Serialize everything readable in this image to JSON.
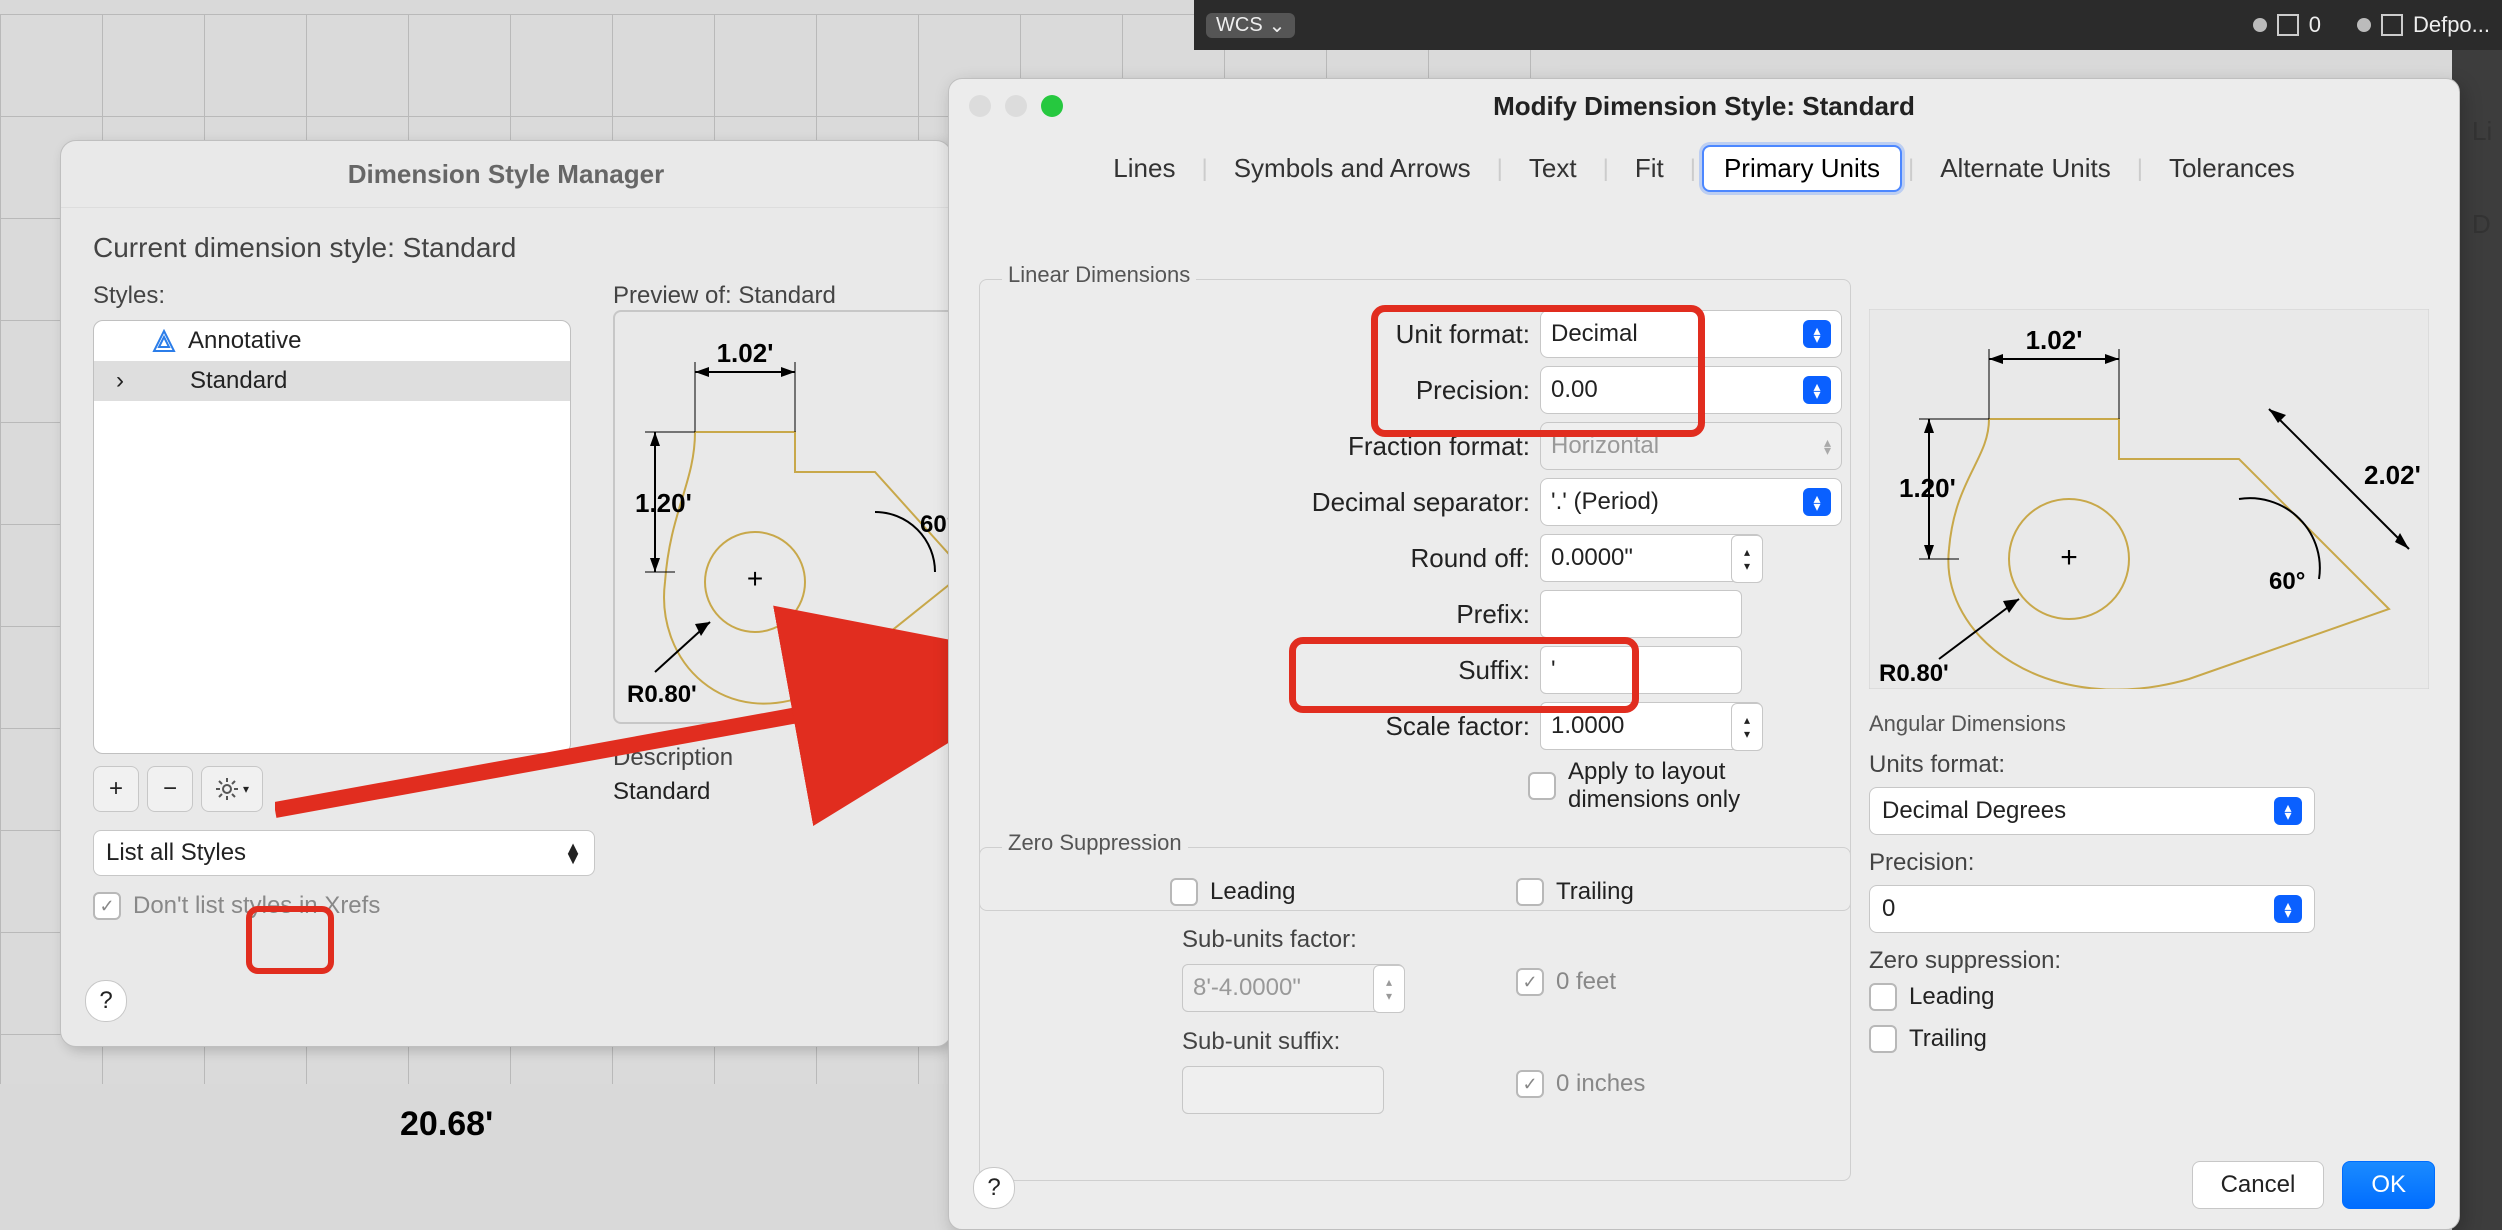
{
  "topbar": {
    "wcs": "WCS",
    "layers": [
      {
        "name": "0"
      },
      {
        "name": "Defpo..."
      }
    ],
    "right_tabs": [
      "Li",
      "D"
    ]
  },
  "drawing_dim": "20.68'",
  "preview_dims": {
    "top": "1.02'",
    "left": "1.20'",
    "angle": "60°",
    "radius": "R0.80'",
    "right": "2.02'"
  },
  "win_style_mgr": {
    "title": "Dimension Style Manager",
    "current_label": "Current dimension style: Standard",
    "styles_label": "Styles:",
    "preview_label": "Preview of: Standard",
    "styles": [
      "Annotative",
      "Standard"
    ],
    "selected_style_index": 1,
    "filter_label": "List all Styles",
    "xref_label": "Don't list styles in Xrefs",
    "desc_label": "Description",
    "desc_value": "Standard",
    "btn_add": "+",
    "btn_remove": "−"
  },
  "win_modify": {
    "title": "Modify Dimension Style: Standard",
    "tabs": [
      "Lines",
      "Symbols and Arrows",
      "Text",
      "Fit",
      "Primary Units",
      "Alternate Units",
      "Tolerances"
    ],
    "active_tab_index": 4,
    "linear_group": "Linear Dimensions",
    "fields": {
      "unit_format": {
        "label": "Unit format:",
        "value": "Decimal"
      },
      "precision": {
        "label": "Precision:",
        "value": "0.00"
      },
      "fraction_format": {
        "label": "Fraction format:",
        "value": "Horizontal"
      },
      "decimal_sep": {
        "label": "Decimal separator:",
        "value": "'.' (Period)"
      },
      "round_off": {
        "label": "Round off:",
        "value": "0.0000\""
      },
      "prefix": {
        "label": "Prefix:",
        "value": ""
      },
      "suffix": {
        "label": "Suffix:",
        "value": "'"
      },
      "scale_factor": {
        "label": "Scale factor:",
        "value": "1.0000"
      },
      "apply_layout": "Apply to layout dimensions only"
    },
    "zero_group": "Zero Suppression",
    "zero": {
      "leading": "Leading",
      "trailing": "Trailing",
      "sub_factor_label": "Sub-units factor:",
      "sub_factor_value": "8'-4.0000\"",
      "sub_suffix_label": "Sub-unit suffix:",
      "zero_feet": "0 feet",
      "zero_inches": "0 inches"
    },
    "angular_group": "Angular Dimensions",
    "angular": {
      "units_label": "Units format:",
      "units_value": "Decimal Degrees",
      "precision_label": "Precision:",
      "precision_value": "0",
      "zero_label": "Zero suppression:",
      "leading": "Leading",
      "trailing": "Trailing"
    },
    "cancel": "Cancel",
    "ok": "OK"
  }
}
